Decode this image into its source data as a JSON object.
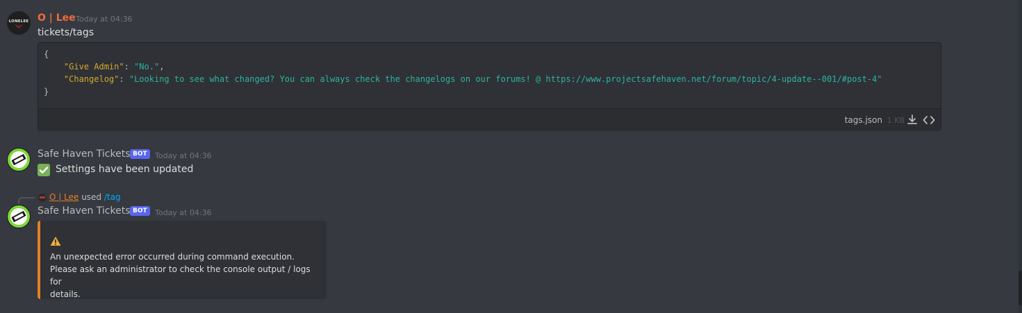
{
  "messages": [
    {
      "author": "O | Lee",
      "author_color": "#f06c3a",
      "avatar_text": "LONELEE",
      "timestamp": "Today at 04:36",
      "content": "tickets/tags",
      "code_block": {
        "lines": {
          "open": "{",
          "l1_key": "\"Give Admin\"",
          "l1_sep": ": ",
          "l1_val": "\"No.\"",
          "l1_end": ",",
          "l2_key": "\"Changelog\"",
          "l2_sep": ": ",
          "l2_val": "\"Looking to see what changed? You can always check the changelogs on our forums! @ https://www.projectsafehaven.net/forum/topic/4-update--001/#post-4\"",
          "close": "}"
        },
        "file_name": "tags.json",
        "file_size": "1 KB",
        "download_icon": "download-icon",
        "expand_icon": "code-expand-icon"
      }
    },
    {
      "author": "Safe Haven Tickets",
      "author_color": "#b9bbbe",
      "badge": "BOT",
      "timestamp": "Today at 04:36",
      "emoji": "white-check-mark",
      "content": "Settings have been updated"
    },
    {
      "reply": {
        "user": "O | Lee",
        "used": "used",
        "command": "/tag"
      },
      "author": "Safe Haven Tickets",
      "author_color": "#b9bbbe",
      "badge": "BOT",
      "timestamp": "Today at 04:36",
      "embed": {
        "accent_color": "#e67e22",
        "icon": "warning-icon",
        "line1": "An unexpected error occurred during command execution.",
        "line2": "Please ask an administrator to check the console output / logs for",
        "line3": "details."
      }
    }
  ]
}
